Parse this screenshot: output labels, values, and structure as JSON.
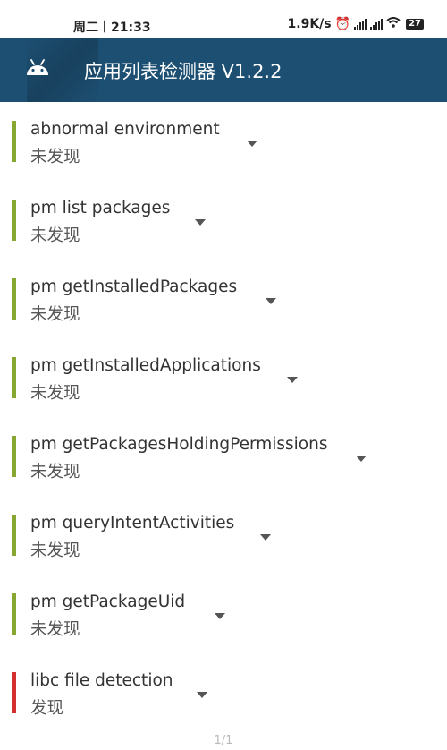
{
  "status_bar": {
    "time": "周二丨21:33",
    "network_speed": "1.9K/s",
    "battery": "27"
  },
  "app_bar": {
    "title": "应用列表检测器 V1.2.2",
    "logo_icon": "android-robot-icon",
    "color": "#1d4f72"
  },
  "colors": {
    "ok": "#86a832",
    "alert": "#d32f2f"
  },
  "checks": [
    {
      "title": "abnormal environment",
      "status": "未发现",
      "level": "ok"
    },
    {
      "title": "pm list packages",
      "status": "未发现",
      "level": "ok"
    },
    {
      "title": "pm getInstalledPackages",
      "status": "未发现",
      "level": "ok"
    },
    {
      "title": "pm getInstalledApplications",
      "status": "未发现",
      "level": "ok"
    },
    {
      "title": "pm getPackagesHoldingPermissions",
      "status": "未发现",
      "level": "ok"
    },
    {
      "title": "pm queryIntentActivities",
      "status": "未发现",
      "level": "ok"
    },
    {
      "title": "pm getPackageUid",
      "status": "未发现",
      "level": "ok"
    },
    {
      "title": "libc file detection",
      "status": "发现",
      "level": "alert"
    }
  ],
  "page_indicator": "1/1"
}
